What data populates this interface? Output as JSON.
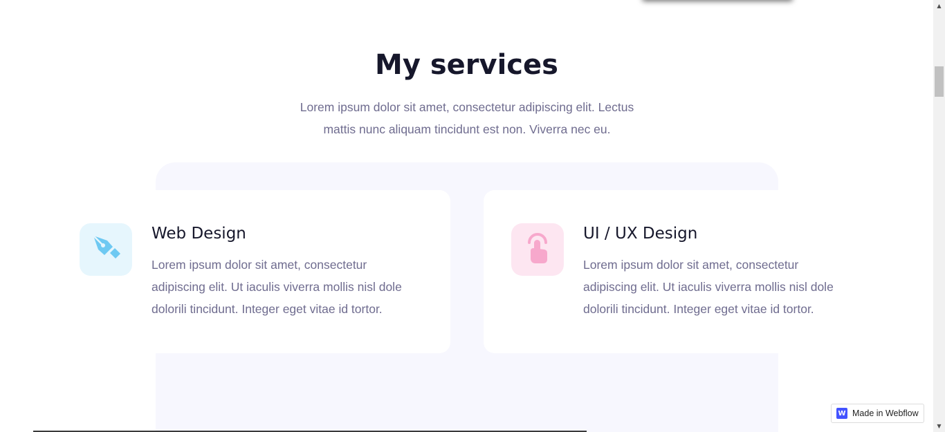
{
  "section": {
    "title": "My services",
    "subtitle": "Lorem ipsum dolor sit amet, consectetur adipiscing elit. Lectus mattis nunc aliquam tincidunt est non. Viverra nec eu."
  },
  "services": [
    {
      "title": "Web Design",
      "description": "Lorem ipsum dolor sit amet, consectetur adipiscing elit. Ut iaculis viverra mollis nisl dole dolorili tincidunt. Integer eget vitae id tortor.",
      "icon": "pen-tool-icon",
      "accent": "#6ec9f2",
      "tile_bg": "#e6f6fd"
    },
    {
      "title": "UI / UX Design",
      "description": "Lorem ipsum dolor sit amet, consectetur adipiscing elit. Ut iaculis viverra mollis nisl dole dolorili tincidunt. Integer eget vitae id tortor.",
      "icon": "touch-hand-icon",
      "accent": "#f7a8cc",
      "tile_bg": "#fde6f1"
    }
  ],
  "badge": {
    "logo_letter": "W",
    "label": "Made in Webflow"
  },
  "colors": {
    "heading": "#16172b",
    "body_text": "#6f6c8f",
    "panel_bg": "#f7f7fe",
    "webflow_blue": "#4353ff"
  }
}
